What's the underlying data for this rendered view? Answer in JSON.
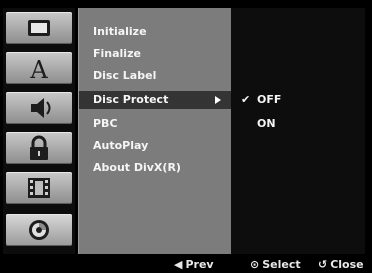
{
  "sidebar": {
    "icons": [
      {
        "name": "tv-screen-icon"
      },
      {
        "name": "language-a-icon"
      },
      {
        "name": "audio-speaker-icon"
      },
      {
        "name": "lock-icon"
      },
      {
        "name": "film-strip-icon"
      },
      {
        "name": "disc-icon"
      }
    ],
    "selected_index": 5
  },
  "menu": {
    "items": [
      {
        "label": "Initialize"
      },
      {
        "label": "Finalize"
      },
      {
        "label": "Disc Label"
      },
      {
        "label": "Disc Protect"
      },
      {
        "label": "PBC"
      },
      {
        "label": "AutoPlay"
      },
      {
        "label": "About DivX(R)"
      }
    ],
    "highlighted_index": 3
  },
  "options": {
    "items": [
      {
        "label": "OFF",
        "checked": true
      },
      {
        "label": "ON",
        "checked": false
      }
    ],
    "check_glyph": "✔"
  },
  "footer": {
    "prev": {
      "glyph": "◀",
      "label": "Prev"
    },
    "select": {
      "glyph": "⊙",
      "label": "Select"
    },
    "close": {
      "glyph": "↺",
      "label": "Close"
    }
  },
  "colors": {
    "menu_bg": "#7c7c7c",
    "highlight_bg": "#343434",
    "option_bg": "#0d0d0d",
    "text": "#f5f5f5"
  }
}
